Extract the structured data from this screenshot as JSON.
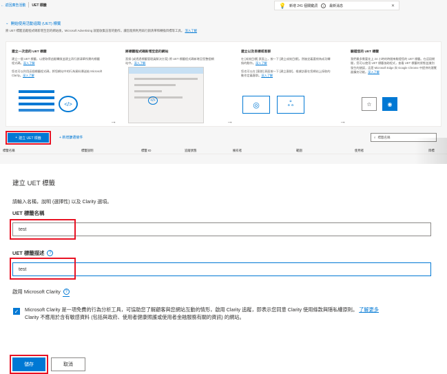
{
  "breadcrumb": {
    "back_label": "← 返回廣告活動",
    "current": "UET 標籤"
  },
  "notification": {
    "text": "新增 241 個關鍵詞",
    "latest_label": "最新消息"
  },
  "learn": {
    "title": "開始使用活動追蹤 (UET) 標籤",
    "desc": "將 UET 標籤追蹤程式碼新增至您的網站後，Microsoft Advertising 就能收集訪客的動作，讓您能夠利用再行銷清單和轉換目標等工具。",
    "link": "深入了解"
  },
  "cards": [
    {
      "title": "建立一次您的 UET 標籤",
      "body": "建立一個 UET 標籤，以便取得追蹤轉換並建立再行銷清單所需的標籤程式碼。",
      "link": "深入了解",
      "body2": "您也可以利用這個標籤程式碼，將您網站中的行為資料傳送給 Microsoft Clarity。",
      "link2": "深入了解"
    },
    {
      "title": "將標籤程式碼新增至您的網站",
      "body": "直接 (或透過標籤管理員解決方案) 將 UET 標籤程式碼新增至您整個網站中。",
      "link": "深入了解"
    },
    {
      "title": "建立以及目標或客群",
      "body": "在 [成效目標] 頁面上，按一下 [建立成效目標]，然後定義要視為成功轉換的動作。",
      "link": "深入了解",
      "body2": "您也可以在 [客群] 頁面按一下 [建立客群]，根據訪客在您網站上採取的動作定義客群。",
      "link2": "深入了解"
    },
    {
      "title": "驗證您的 UET 標籤",
      "body": "我們最多需要花上 24 小時的時間來驗證您的 UET 標籤。在這段期間，您可以使用 UET 標籤協助程式，查看 UET 標籤的狀態並識別發生的錯誤，這是 Microsoft Edge 與 Google Chrome 中提供的瀏覽器擴充功能。",
      "link": "深入了解"
    }
  ],
  "toolbar": {
    "create_label": "建立 UET 標籤",
    "download_label": "新增篩選條件",
    "search_placeholder": "標籤名稱"
  },
  "columns": [
    "標籤名稱",
    "標籤說明",
    "標籤 ID",
    "追蹤狀態",
    "擁有者",
    "範圍",
    "使用者",
    "目標"
  ],
  "form": {
    "title": "建立 UET 標籤",
    "desc": "請輸入名稱，說明 (選擇性) 以及 Clarity 選項。",
    "name_label": "UET 標籤名稱",
    "name_value": "test",
    "desc_label": "UET 標籤描述",
    "desc_value": "test",
    "clarity_label": "啟用 Microsoft Clarity",
    "clarity_text": "Microsoft Clarity 是一項免費的行為分析工具，可協助您了解顧客與您網站互動的情形，啟用 Clarity 追蹤，即表示您同意 Clarity 使用條款與隱私權原則。",
    "clarity_link": "了解更多",
    "clarity_text2": "Clarity 不應用於含有敏感資料 (包括與政府、使用者健康照護或使用者金融服務有關的資訊) 的網站。",
    "save_label": "儲存",
    "cancel_label": "取消"
  },
  "colors": {
    "accent": "#0078d4",
    "highlight": "#e81123"
  }
}
